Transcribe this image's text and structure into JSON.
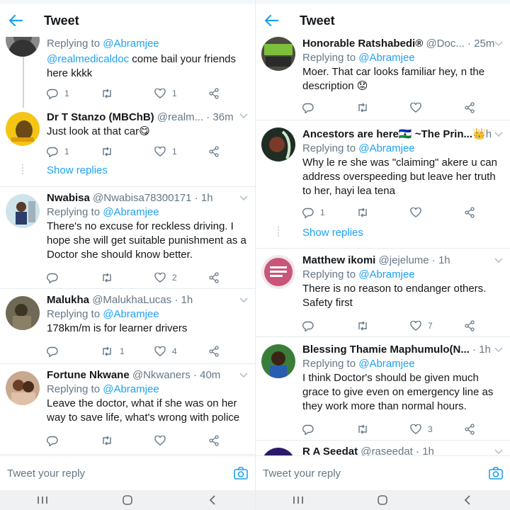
{
  "screen_title": "Tweet",
  "reply_placeholder": "Tweet your reply",
  "show_replies": "Show replies",
  "replying_to_prefix": "Replying to ",
  "replying_to_handle": "@Abramjee",
  "colors": {
    "accent": "#1da1f2",
    "text": "#14171a",
    "secondary": "#657786",
    "divider": "#e6ecf0"
  },
  "left": {
    "tweets": [
      {
        "name": "",
        "handle": "",
        "time": "",
        "replying": "@Abramjee",
        "mention": "@realmedicaldoc",
        "body": " come bail your friends here kkkk",
        "reply_count": "1",
        "retweet_count": "",
        "like_count": "1"
      },
      {
        "name": "Dr T Stanzo (MBChB)",
        "handle": "@realm...",
        "time": "· 36m",
        "body": "Just look at that car😋",
        "reply_count": "1",
        "retweet_count": "",
        "like_count": "1"
      },
      {
        "name": "Nwabisa",
        "handle": "@Nwabisa78300171",
        "time": "· 1h",
        "replying": "@Abramjee",
        "body": "There's no excuse for reckless driving. I hope she will get suitable punishment as a Doctor she should know better.",
        "reply_count": "",
        "retweet_count": "",
        "like_count": "2"
      },
      {
        "name": "Malukha",
        "handle": "@MalukhaLucas",
        "time": "· 1h",
        "replying": "@Abramjee",
        "body": "178km/m is for learner drivers",
        "reply_count": "",
        "retweet_count": "1",
        "like_count": "4"
      },
      {
        "name": "Fortune Nkwane",
        "handle": "@Nkwaners",
        "time": "· 40m",
        "replying": "@Abramjee",
        "body": "Leave the doctor, what if she was on her way to save life, what's wrong with police",
        "reply_count": "",
        "retweet_count": "",
        "like_count": ""
      }
    ]
  },
  "right": {
    "tweets": [
      {
        "name": "Honorable Ratshabedi®",
        "handle": "@Doc...",
        "time": "· 25m",
        "replying": "@Abramjee",
        "body": "Moer. That car looks familiar hey, n the description 😟",
        "reply_count": "",
        "retweet_count": "",
        "like_count": ""
      },
      {
        "name": "Ancestors are here🇱🇸 ~The Prin...👑",
        "handle": "",
        "time": "h",
        "replying": "@Abramjee",
        "body": "Why le re she was \"claiming\" akere u can address overspeeding but leave her truth to her, hayi lea tena",
        "reply_count": "1",
        "retweet_count": "",
        "like_count": ""
      },
      {
        "name": "Matthew ikomi",
        "handle": "@jejelume",
        "time": "· 1h",
        "replying": "@Abramjee",
        "body": "There is no reason to endanger others. Safety first",
        "reply_count": "",
        "retweet_count": "",
        "like_count": "7"
      },
      {
        "name": "Blessing Thamie Maphumulo(N...",
        "handle": "",
        "time": "· 1h",
        "replying": "@Abramjee",
        "body": "I think Doctor's should be given much grace to give even on emergency line as they work more than normal hours.",
        "reply_count": "",
        "retweet_count": "",
        "like_count": "3"
      },
      {
        "name": "R A Seedat",
        "handle": "@raseedat",
        "time": "· 1h",
        "replying": "",
        "body": "",
        "reply_count": "",
        "retweet_count": "",
        "like_count": ""
      }
    ]
  }
}
